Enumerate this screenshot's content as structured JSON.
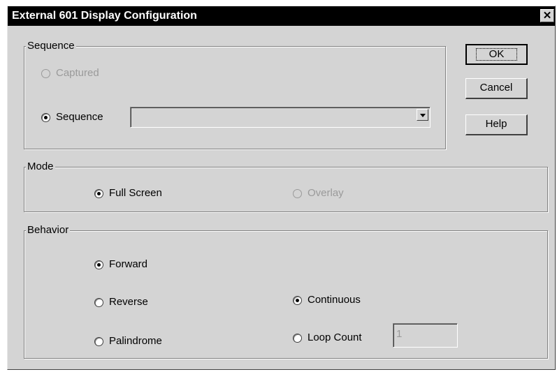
{
  "window": {
    "title": "External 601 Display Configuration",
    "close_glyph": "✕"
  },
  "sequence_group": {
    "legend": "Sequence",
    "captured_label": "Captured",
    "sequence_label": "Sequence",
    "sequence_value": ""
  },
  "mode_group": {
    "legend": "Mode",
    "full_screen_label": "Full Screen",
    "overlay_label": "Overlay"
  },
  "behavior_group": {
    "legend": "Behavior",
    "forward_label": "Forward",
    "reverse_label": "Reverse",
    "palindrome_label": "Palindrome",
    "continuous_label": "Continuous",
    "loop_count_label": "Loop Count",
    "loop_count_value": "1"
  },
  "buttons": {
    "ok": "OK",
    "cancel": "Cancel",
    "help": "Help"
  }
}
